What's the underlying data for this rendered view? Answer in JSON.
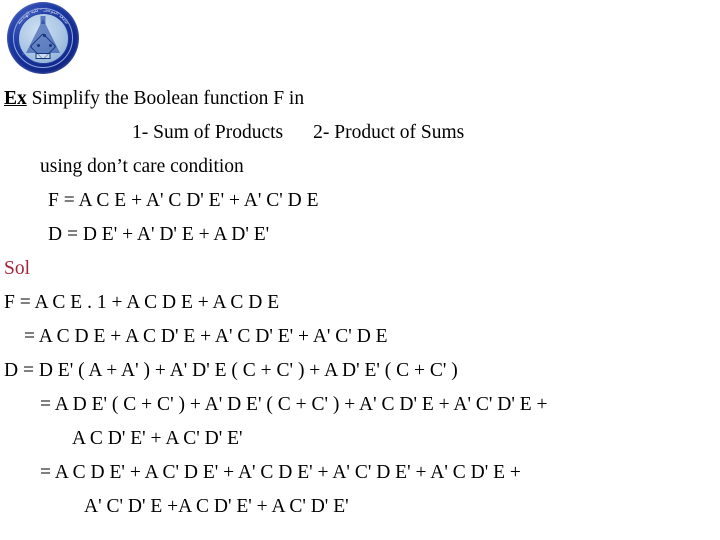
{
  "logo": {
    "name": "university-seal",
    "arc_text_top": "جامعة الموصل - كلية الهندسة",
    "arc_text_bottom": "University of Mosul - College of Engineering",
    "colors": {
      "ring": "#15339b",
      "inner": "#a9c5e4",
      "emblem": "#16357f"
    }
  },
  "slide": {
    "heading": {
      "label": "Ex",
      "text": "Simplify the Boolean function F in"
    },
    "options": {
      "first": "1- Sum of Products",
      "second": "2- Product of Sums"
    },
    "condition": "using don’t care condition",
    "given": {
      "f": "F = A C E + A' C D' E' + A' C' D E",
      "d": "D = D E' + A' D' E + A D' E'"
    },
    "solution_label": "Sol",
    "solution_lines": [
      "F = A C E . 1 + A C D E + A C D E",
      "= A C D E + A C D' E + A' C D' E' + A' C' D E",
      "D = D E' ( A + A' ) + A' D' E ( C + C' ) + A D' E' ( C + C' )",
      "= A D E' ( C + C' ) + A' D E' ( C + C' ) + A' C D' E + A' C' D' E +",
      "A C D' E' + A C' D' E'",
      "= A C D E' + A C' D E' + A' C D E' + A' C' D E' + A' C D' E +",
      "A' C' D' E +A C D' E' + A C' D' E'"
    ]
  },
  "colors": {
    "text": "#000000",
    "accent_red": "#A32638",
    "background": "#FFFFFF"
  }
}
